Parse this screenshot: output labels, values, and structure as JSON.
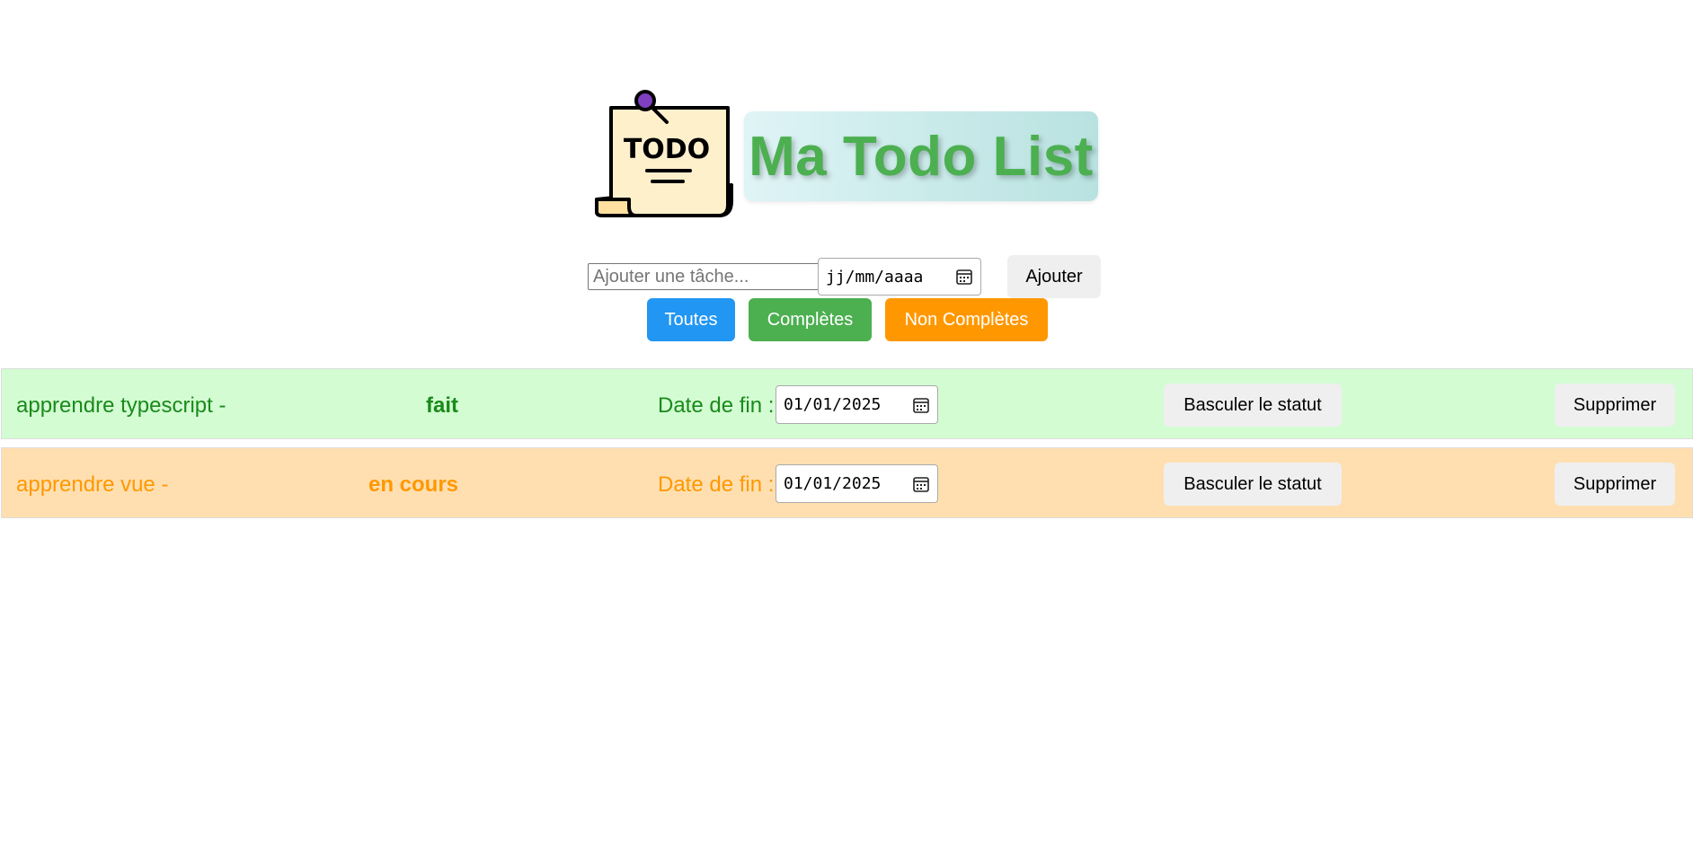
{
  "header": {
    "logo_text": "TODO",
    "title": "Ma Todo List"
  },
  "add_form": {
    "task_placeholder": "Ajouter une tâche...",
    "date_placeholder": "jj/mm/aaaa",
    "add_label": "Ajouter"
  },
  "filters": {
    "all": "Toutes",
    "completed": "Complètes",
    "not_completed": "Non Complètes"
  },
  "tasks": [
    {
      "name": "apprendre typescript -",
      "status": "fait",
      "date_label": "Date de fin :",
      "date": "01/01/2025",
      "toggle_label": "Basculer le statut",
      "delete_label": "Supprimer"
    },
    {
      "name": "apprendre vue -",
      "status": "en cours",
      "date_label": "Date de fin :",
      "date": "01/01/2025",
      "toggle_label": "Basculer le statut",
      "delete_label": "Supprimer"
    }
  ],
  "colors": {
    "title_green": "#4caf50",
    "filter_all": "#2196f3",
    "filter_completed": "#4caf50",
    "filter_not_completed": "#ff9800",
    "row_done_bg": "#d3fcd3",
    "row_todo_bg": "#ffdfb0"
  }
}
